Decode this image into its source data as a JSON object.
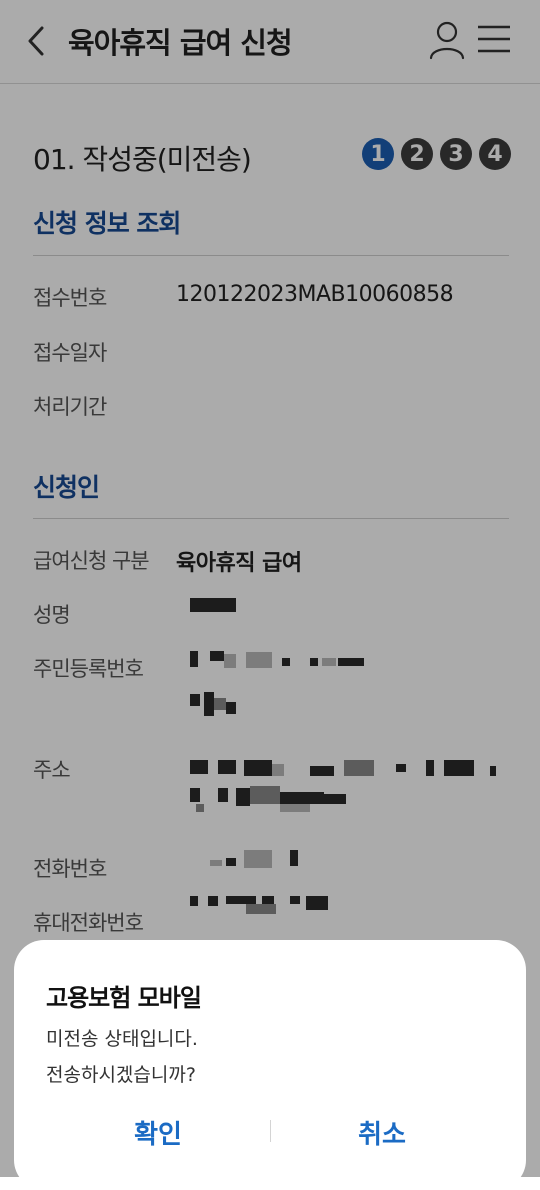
{
  "header": {
    "title": "육아휴직 급여 신청",
    "back_icon": "chevron-left-icon",
    "user_icon": "user-icon",
    "menu_icon": "hamburger-menu-icon"
  },
  "status": {
    "text": "01. 작성중(미전송)",
    "steps": [
      "1",
      "2",
      "3",
      "4"
    ],
    "active_step": "1",
    "active_color": "#1b5fb3",
    "inactive_color": "#3d3d3d"
  },
  "section_inquiry": {
    "title": "신청 정보 조회",
    "rows": [
      {
        "label": "접수번호",
        "value": "120122023MAB10060858"
      },
      {
        "label": "접수일자",
        "value": ""
      },
      {
        "label": "처리기간",
        "value": ""
      }
    ]
  },
  "section_applicant": {
    "title": "신청인",
    "rows": [
      {
        "label": "급여신청 구분",
        "value": "육아휴직 급여"
      },
      {
        "label": "성명"
      },
      {
        "label": "주민등록번호"
      },
      {
        "label": "주소"
      },
      {
        "label": "전화번호"
      },
      {
        "label": "휴대전화번호"
      }
    ]
  },
  "dialog": {
    "title": "고용보험 모바일",
    "message_line1": "미전송 상태입니다.",
    "message_line2": "전송하시겠습니까?",
    "confirm_label": "확인",
    "cancel_label": "취소",
    "accent_color": "#1b6bc4"
  }
}
